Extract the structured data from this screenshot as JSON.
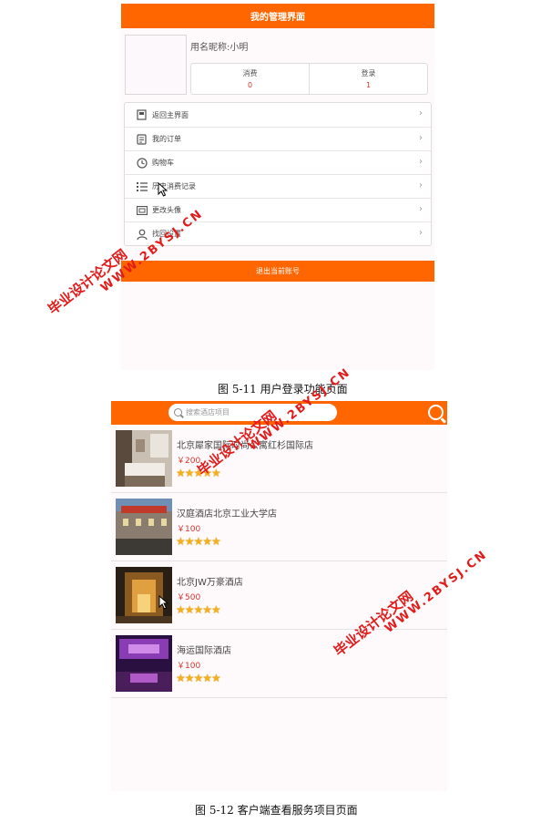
{
  "screen1": {
    "header_title": "我的管理界面",
    "nickname": "用名昵称:小明",
    "stats": [
      {
        "label": "消费",
        "value": "0"
      },
      {
        "label": "登录",
        "value": "1"
      }
    ],
    "menu": [
      {
        "label": "返回主界面",
        "icon": "home-icon"
      },
      {
        "label": "我的订单",
        "icon": "order-icon"
      },
      {
        "label": "购物车",
        "icon": "clock-icon"
      },
      {
        "label": "历史消费记录",
        "icon": "list-icon"
      },
      {
        "label": "更改头像",
        "icon": "card-icon"
      },
      {
        "label": "找回设置",
        "icon": "user-icon"
      }
    ],
    "logout_label": "退出当前账号"
  },
  "caption1": "图 5-11 用户登录功能页面",
  "screen2": {
    "search_placeholder": "搜索酒店项目",
    "hotels": [
      {
        "name": "北京犀家国际时尚公寓红杉国际店",
        "price": "￥200",
        "stars": "★★★★★"
      },
      {
        "name": "汉庭酒店北京工业大学店",
        "price": "￥100",
        "stars": "★★★★★"
      },
      {
        "name": "北京JW万豪酒店",
        "price": "￥500",
        "stars": "★★★★★"
      },
      {
        "name": "海运国际酒店",
        "price": "￥100",
        "stars": "★★★★★"
      }
    ]
  },
  "caption2": "图 5-12 客户端查看服务项目页面",
  "watermarks": {
    "cn": "毕业设计论文网",
    "url": "WWW.2BYSJ.CN"
  },
  "colors": {
    "accent": "#ff6600",
    "price": "#d9342b",
    "star": "#f2b01e",
    "watermark": "#e21b1b"
  }
}
